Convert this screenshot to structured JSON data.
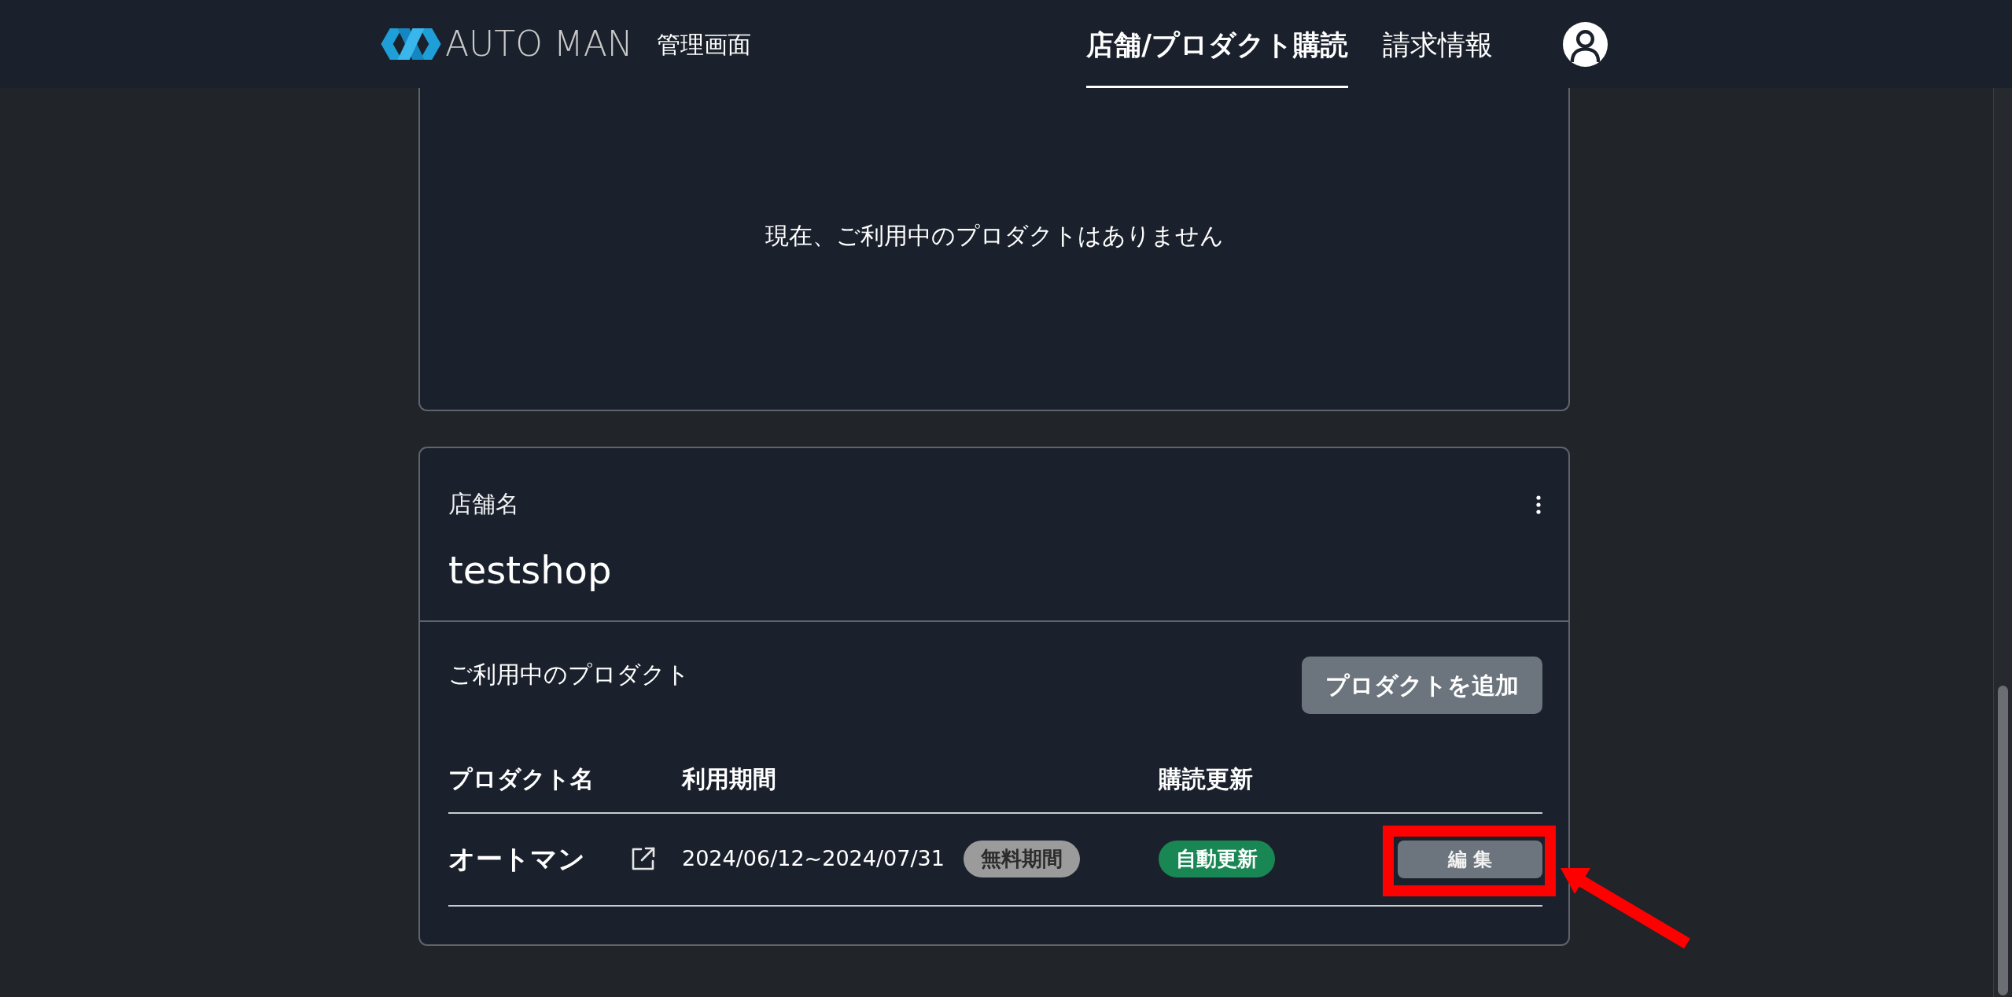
{
  "header": {
    "logo_text": "AUTO MAN",
    "subtitle": "管理画面",
    "nav": [
      {
        "label": "店舗/プロダクト購読",
        "selected": true
      },
      {
        "label": "請求情報",
        "selected": false
      }
    ]
  },
  "empty_card": {
    "message": "現在、ご利用中のプロダクトはありません"
  },
  "shop_card": {
    "label": "店舗名",
    "name": "testshop",
    "section_title": "ご利用中のプロダクト",
    "add_button": "プロダクトを追加",
    "table": {
      "columns": [
        "プロダクト名",
        "利用期間",
        "購読更新"
      ],
      "rows": [
        {
          "product": "オートマン",
          "period": "2024/06/12~2024/07/31",
          "period_badge": "無料期間",
          "renewal": "自動更新",
          "edit_button": {
            "label": "編 集",
            "highlighted": true
          }
        }
      ]
    }
  }
}
